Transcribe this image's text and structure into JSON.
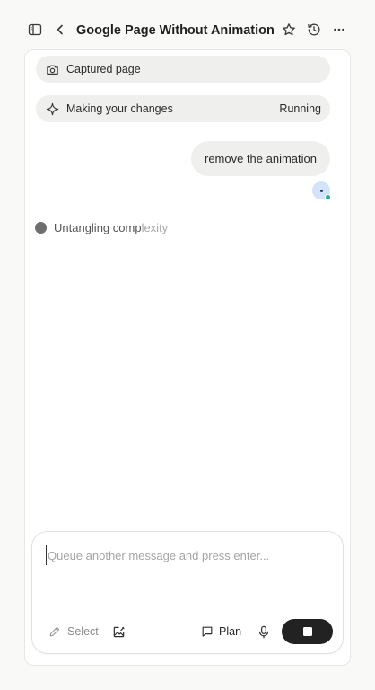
{
  "header": {
    "title": "Google Page Without Animation"
  },
  "chat": {
    "captured_page_label": "Captured page",
    "task_label": "Making your changes",
    "task_status": "Running",
    "user_message": "remove the animation",
    "thinking_text_a": "Untangling comp",
    "thinking_text_b": "lexity"
  },
  "composer": {
    "placeholder": "Queue another message and press enter...",
    "select_label": "Select",
    "plan_label": "Plan"
  },
  "icons": {
    "sidebar": "sidebar-toggle-icon",
    "back": "chevron-left-icon",
    "star": "star-icon",
    "history": "history-icon",
    "more": "more-horizontal-icon",
    "camera": "camera-icon",
    "sparkle": "sparkle-icon",
    "pencil": "pencil-icon",
    "edit_image": "edit-image-icon",
    "comment": "comment-icon",
    "mic": "microphone-icon",
    "stop": "stop-icon"
  },
  "colors": {
    "accent_online": "#1fb58a",
    "avatar_bg": "#d2e3fb",
    "stop_button": "#222222"
  }
}
